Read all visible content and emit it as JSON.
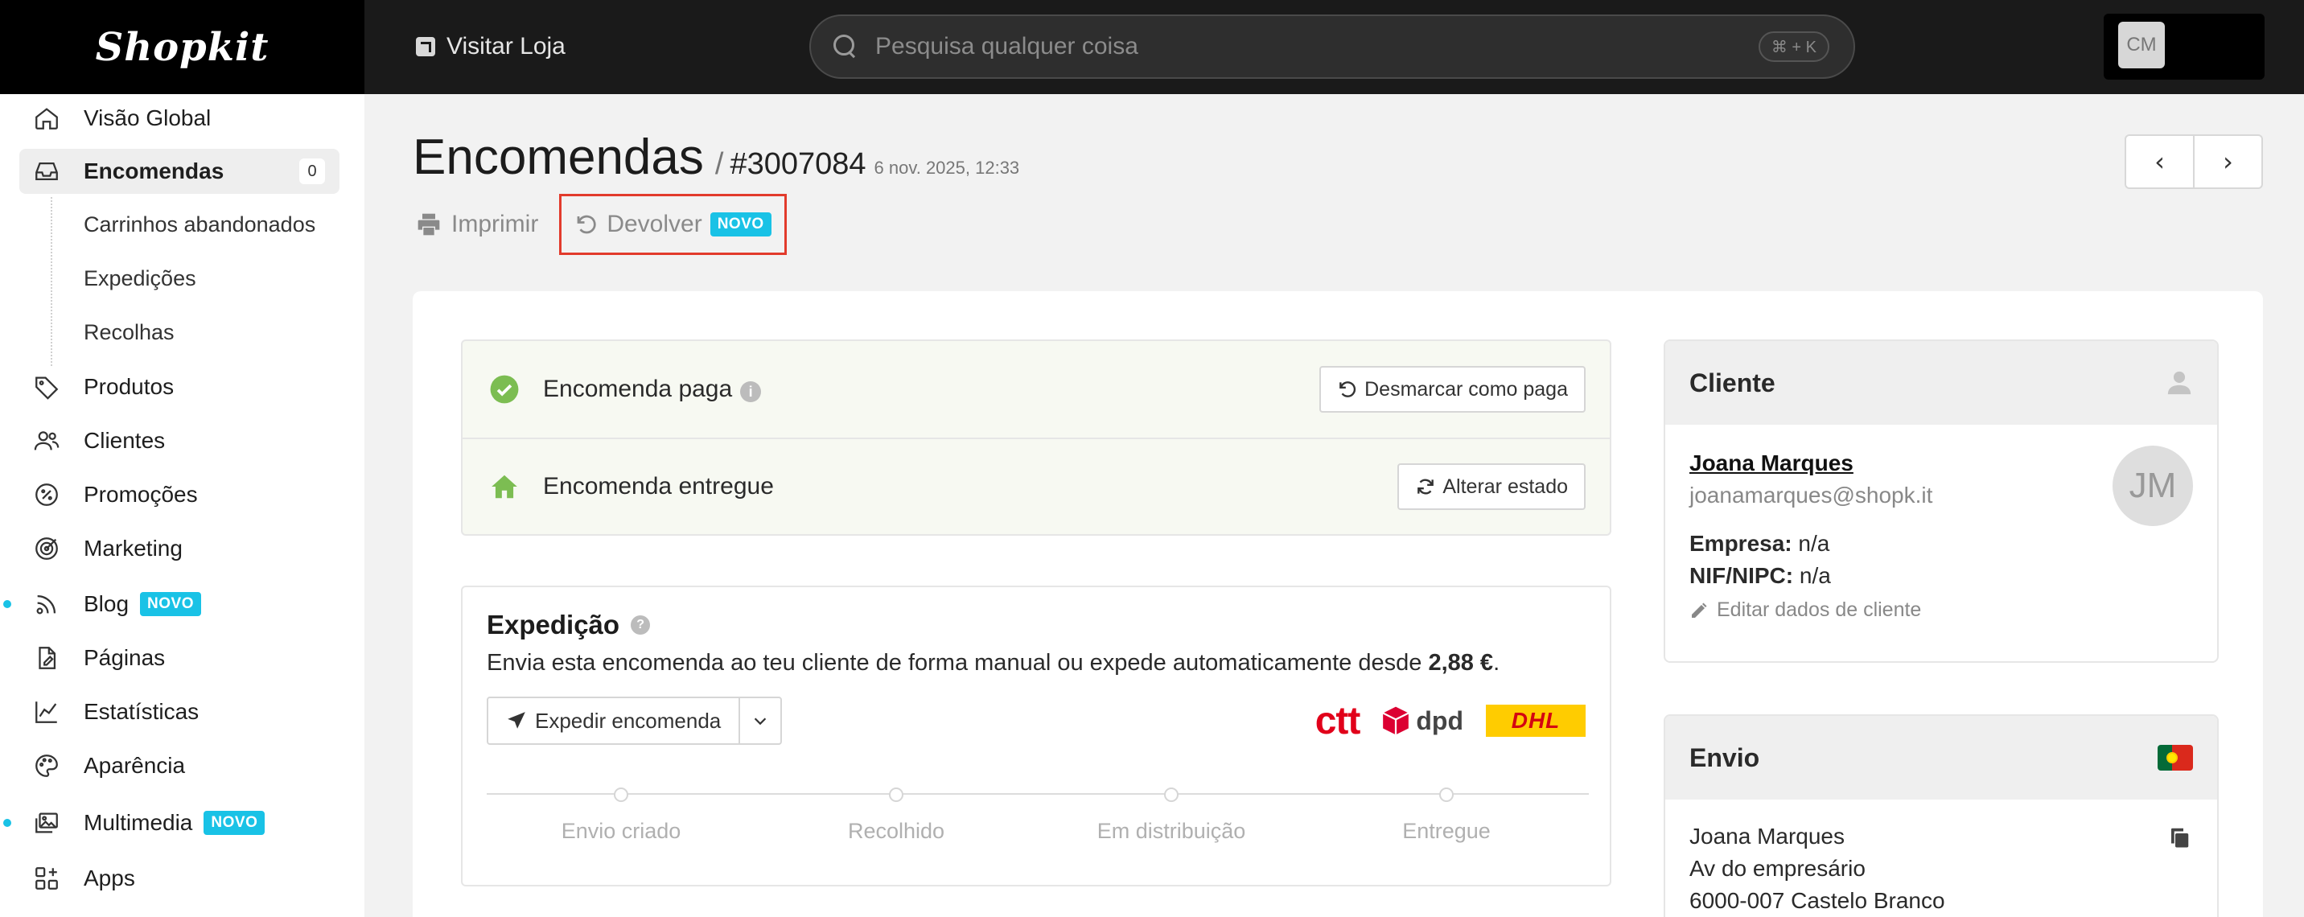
{
  "topbar": {
    "brand": "Shopkit",
    "visit_store": "Visitar Loja",
    "search_placeholder": "Pesquisa qualquer coisa",
    "search_shortcut": "⌘ + K",
    "user_initials": "CM"
  },
  "sidebar": {
    "items": [
      {
        "label": "Visão Global",
        "icon": "home-icon"
      },
      {
        "label": "Encomendas",
        "icon": "inbox-icon",
        "count": "0"
      },
      {
        "label": "Produtos",
        "icon": "tag-icon"
      },
      {
        "label": "Clientes",
        "icon": "users-icon"
      },
      {
        "label": "Promoções",
        "icon": "discount-icon"
      },
      {
        "label": "Marketing",
        "icon": "target-icon"
      },
      {
        "label": "Blog",
        "icon": "broadcast-icon",
        "badge": "NOVO"
      },
      {
        "label": "Páginas",
        "icon": "page-icon"
      },
      {
        "label": "Estatísticas",
        "icon": "chart-icon"
      },
      {
        "label": "Aparência",
        "icon": "palette-icon"
      },
      {
        "label": "Multimedia",
        "icon": "media-icon",
        "badge": "NOVO"
      },
      {
        "label": "Apps",
        "icon": "apps-icon"
      }
    ],
    "sub_items": [
      "Carrinhos abandonados",
      "Expedições",
      "Recolhas"
    ]
  },
  "header": {
    "title": "Encomendas",
    "separator": "/",
    "order_number": "#3007084",
    "order_date": "6 nov. 2025, 12:33",
    "print_label": "Imprimir",
    "return_label": "Devolver",
    "return_badge": "NOVO"
  },
  "status": {
    "paid_label": "Encomenda paga",
    "unmark_paid": "Desmarcar como paga",
    "delivered_label": "Encomenda entregue",
    "change_status": "Alterar estado"
  },
  "shipping": {
    "title": "Expedição",
    "description": "Envia esta encomenda ao teu cliente de forma manual ou expede automaticamente desde",
    "price": "2,88 €",
    "price_suffix": ".",
    "ship_button": "Expedir encomenda",
    "carriers": [
      "ctt",
      "dpd",
      "DHL"
    ],
    "steps": [
      "Envio criado",
      "Recolhido",
      "Em distribuição",
      "Entregue"
    ]
  },
  "customer": {
    "card_title": "Cliente",
    "name": "Joana Marques",
    "email": "joanamarques@shopk.it",
    "company_label": "Empresa:",
    "company_value": "n/a",
    "nif_label": "NIF/NIPC:",
    "nif_value": "n/a",
    "initials": "JM",
    "edit_label": "Editar dados de cliente"
  },
  "delivery": {
    "card_title": "Envio",
    "name": "Joana Marques",
    "address_line1": "Av do empresário",
    "address_line2": "6000-007 Castelo Branco"
  },
  "colors": {
    "accent": "#19c2e6",
    "success": "#7cbd52",
    "highlight": "#e23b2c"
  }
}
